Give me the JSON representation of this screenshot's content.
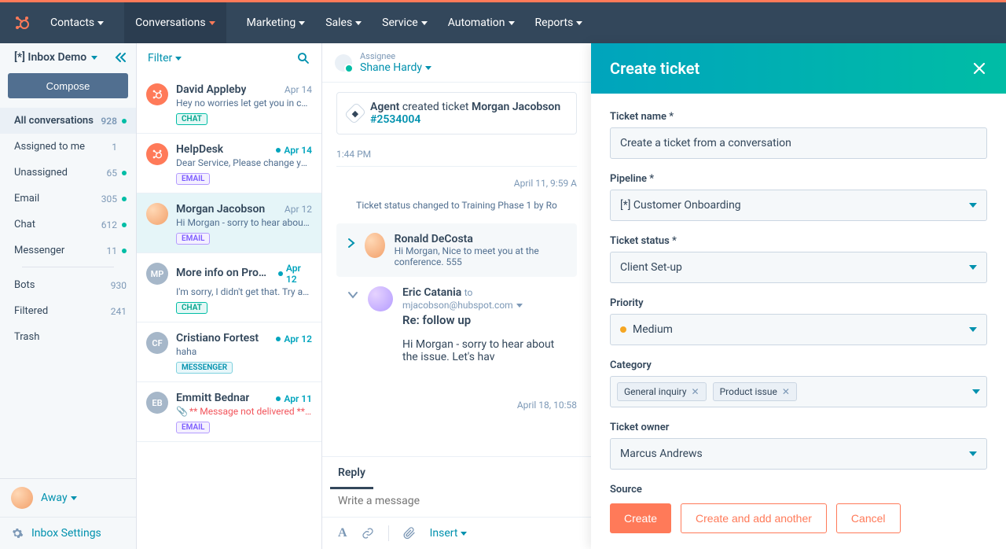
{
  "nav": {
    "items": [
      "Contacts",
      "Conversations",
      "Marketing",
      "Sales",
      "Service",
      "Automation",
      "Reports"
    ]
  },
  "sidebar": {
    "inbox_name": "[*] Inbox Demo",
    "compose": "Compose",
    "groups": [
      {
        "label": "All conversations",
        "count": "928",
        "dot": true,
        "active": true
      },
      {
        "label": "Assigned to me",
        "count": "1",
        "dot": false
      },
      {
        "label": "Unassigned",
        "count": "65",
        "dot": true
      },
      {
        "label": "Email",
        "count": "305",
        "dot": true
      },
      {
        "label": "Chat",
        "count": "612",
        "dot": true
      },
      {
        "label": "Messenger",
        "count": "11",
        "dot": true
      }
    ],
    "groups2": [
      {
        "label": "Bots",
        "count": "930"
      },
      {
        "label": "Filtered",
        "count": "241"
      },
      {
        "label": "Trash",
        "count": ""
      }
    ],
    "status": "Away",
    "settings": "Inbox Settings"
  },
  "threadlist": {
    "filter": "Filter",
    "items": [
      {
        "name": "David Appleby",
        "date": "Apr 14",
        "unread": false,
        "preview": "Hey no worries let get you in cont…",
        "badge": "CHAT",
        "avatar": "hub"
      },
      {
        "name": "HelpDesk",
        "date": "Apr 14",
        "unread": true,
        "preview": "Dear Service, Please change your…",
        "badge": "EMAIL",
        "avatar": "hub"
      },
      {
        "name": "Morgan Jacobson",
        "date": "Apr 12",
        "unread": false,
        "preview": "Hi Morgan - sorry to hear about th…",
        "badge": "EMAIL",
        "avatar": "mj",
        "selected": true
      },
      {
        "name": "More info on Produ…",
        "date": "Apr 12",
        "unread": true,
        "preview": "I'm sorry, I didn't get that. Try aga…",
        "badge": "CHAT",
        "avatar": "MP"
      },
      {
        "name": "Cristiano Fortest",
        "date": "Apr 12",
        "unread": true,
        "preview": "haha",
        "badge": "MESSENGER",
        "avatar": "CF"
      },
      {
        "name": "Emmitt Bednar",
        "date": "Apr 11",
        "unread": true,
        "preview": "** Message not delivered **  Y…",
        "preview_err": true,
        "badge": "EMAIL",
        "avatar": "EB",
        "paperclip": true
      }
    ]
  },
  "center": {
    "assignee_label": "Assignee",
    "assignee_name": "Shane Hardy",
    "sys_agent": "Agent",
    "sys_verb": " created ticket ",
    "sys_who": "Morgan Jacobson",
    "sys_ticket": "#2534004",
    "time1": "1:44 PM",
    "time2": "April 11, 9:59 A",
    "status_change": "Ticket status changed to Training Phase 1 by Ro",
    "msg1_name": "Ronald DeCosta",
    "msg1_sub": "Hi Morgan, Nice to meet you at the conference. 555",
    "msg2_name": "Eric Catania",
    "msg2_to_prefix": "to",
    "msg2_to": "mjacobson@hubspot.com",
    "msg2_subject": "Re: follow up",
    "msg2_body": "Hi Morgan - sorry to hear about the issue. Let's hav",
    "time3": "April 18, 10:58",
    "reply_tab": "Reply",
    "reply_placeholder": "Write a message",
    "insert": "Insert"
  },
  "panel": {
    "title": "Create ticket",
    "fields": {
      "ticket_name_label": "Ticket name *",
      "ticket_name_value": "Create a ticket from a conversation",
      "pipeline_label": "Pipeline *",
      "pipeline_value": "[*] Customer Onboarding",
      "status_label": "Ticket status *",
      "status_value": "Client Set-up",
      "priority_label": "Priority",
      "priority_value": "Medium",
      "category_label": "Category",
      "category_tags": [
        "General inquiry",
        "Product issue"
      ],
      "owner_label": "Ticket owner",
      "owner_value": "Marcus Andrews",
      "source_label": "Source"
    },
    "buttons": {
      "create": "Create",
      "create_add": "Create and add another",
      "cancel": "Cancel"
    }
  }
}
